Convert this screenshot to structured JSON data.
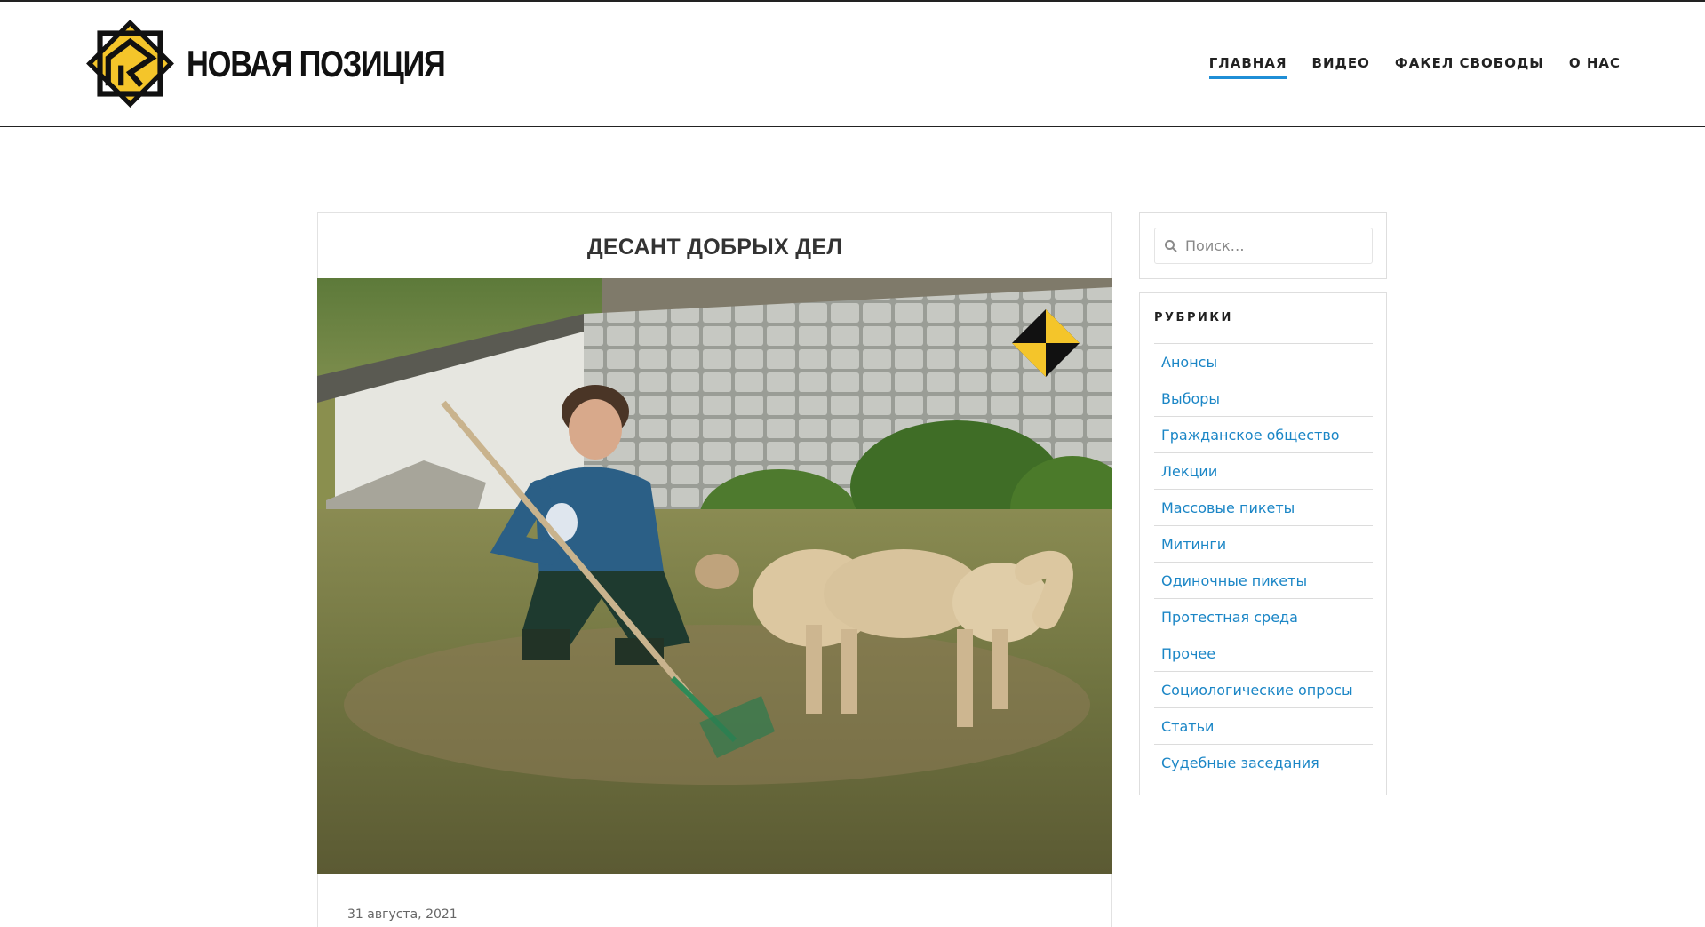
{
  "header": {
    "site_title": "НОВАЯ ПОЗИЦИЯ",
    "logo_icon": "yellow-diamond-logo-icon",
    "brand_color": "#f4c52a",
    "nav": [
      {
        "label": "ГЛАВНАЯ",
        "active": true
      },
      {
        "label": "ВИДЕО",
        "active": false
      },
      {
        "label": "ФАКЕЛ СВОБОДЫ",
        "active": false
      },
      {
        "label": "О НАС",
        "active": false
      }
    ],
    "nav_active_color": "#1f8ed6"
  },
  "article": {
    "title": "ДЕСАНТ ДОБРЫХ ДЕЛ",
    "image_icon": "article-photo",
    "date": "31 августа, 2021"
  },
  "sidebar": {
    "search": {
      "placeholder": "Поиск…",
      "value": "",
      "icon": "search-icon"
    },
    "categories": {
      "heading": "РУБРИКИ",
      "link_color": "#1b86c6",
      "items": [
        {
          "label": "Анонсы"
        },
        {
          "label": "Выборы"
        },
        {
          "label": "Гражданское общество"
        },
        {
          "label": "Лекции"
        },
        {
          "label": "Массовые пикеты"
        },
        {
          "label": "Митинги"
        },
        {
          "label": "Одиночные пикеты"
        },
        {
          "label": "Протестная среда"
        },
        {
          "label": "Прочее"
        },
        {
          "label": "Социологические опросы"
        },
        {
          "label": "Статьи"
        },
        {
          "label": "Судебные заседания"
        }
      ]
    }
  }
}
